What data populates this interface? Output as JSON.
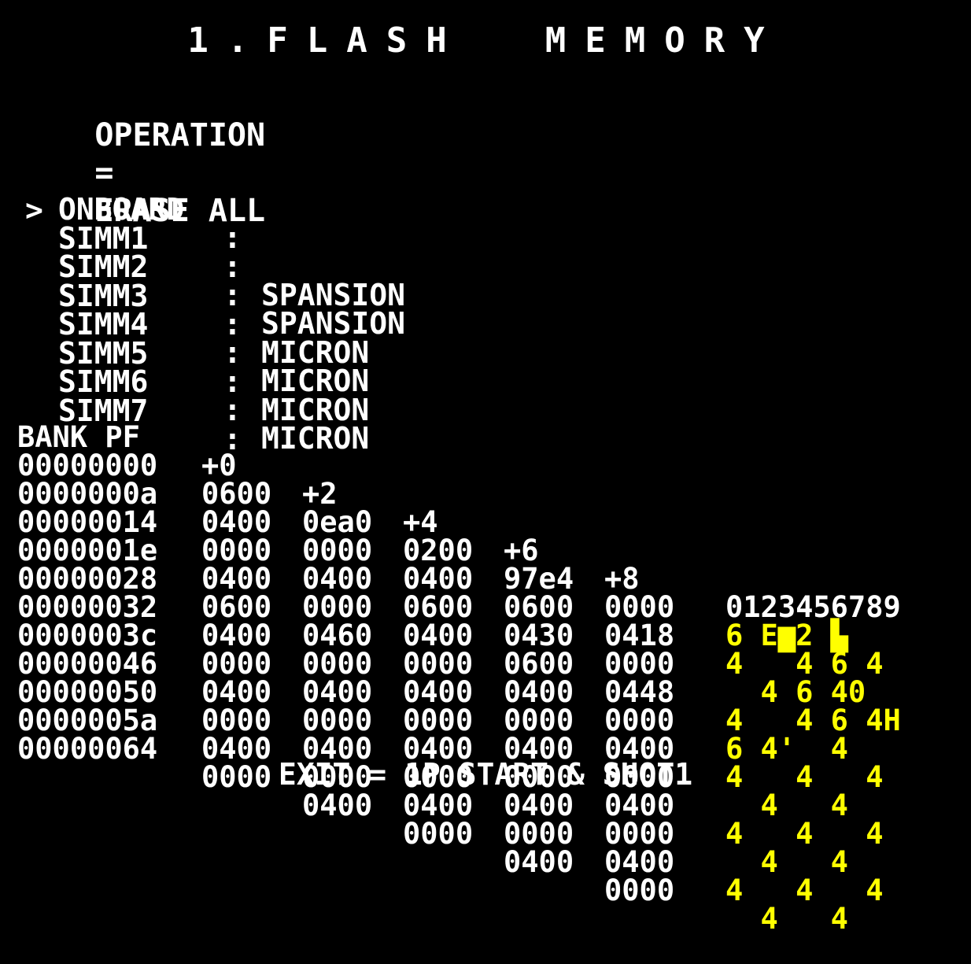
{
  "title": "1.FLASH  MEMORY",
  "operation": {
    "label": "OPERATION",
    "separator": "=",
    "value": "ERASE ALL"
  },
  "devices": [
    {
      "cursor": "",
      "name": "ONBOARD",
      "colon": ":",
      "maker": ""
    },
    {
      "cursor": ">",
      "name": "SIMM1",
      "colon": ":",
      "maker": "SPANSION"
    },
    {
      "cursor": "",
      "name": "SIMM2",
      "colon": ":",
      "maker": "SPANSION"
    },
    {
      "cursor": "",
      "name": "SIMM3",
      "colon": ":",
      "maker": "MICRON"
    },
    {
      "cursor": "",
      "name": "SIMM4",
      "colon": ":",
      "maker": "MICRON"
    },
    {
      "cursor": "",
      "name": "SIMM5",
      "colon": ":",
      "maker": "MICRON"
    },
    {
      "cursor": "",
      "name": "SIMM6",
      "colon": ":",
      "maker": "MICRON"
    },
    {
      "cursor": "",
      "name": "SIMM7",
      "colon": ":",
      "maker": ""
    }
  ],
  "dump": {
    "header": {
      "addr": "BANK PF",
      "w0": "+0",
      "w1": "+2",
      "w2": "+4",
      "w3": "+6",
      "w4": "+8",
      "ascii": "0123456789"
    },
    "rows": [
      {
        "addr": "00000000",
        "w": [
          "0600",
          "0ea0",
          "0200",
          "97e4",
          "0000"
        ],
        "ascii": "6 E▆2 ▙ "
      },
      {
        "addr": "0000000a",
        "w": [
          "0400",
          "0000",
          "0400",
          "0600",
          "0418"
        ],
        "ascii": "4   4 6 4 "
      },
      {
        "addr": "00000014",
        "w": [
          "0000",
          "0400",
          "0600",
          "0430",
          "0000"
        ],
        "ascii": "  4 6 40  "
      },
      {
        "addr": "0000001e",
        "w": [
          "0400",
          "0000",
          "0400",
          "0600",
          "0448"
        ],
        "ascii": "4   4 6 4H"
      },
      {
        "addr": "00000028",
        "w": [
          "0600",
          "0460",
          "0000",
          "0400",
          "0000"
        ],
        "ascii": "6 4'  4   "
      },
      {
        "addr": "00000032",
        "w": [
          "0400",
          "0000",
          "0400",
          "0000",
          "0400"
        ],
        "ascii": "4   4   4 "
      },
      {
        "addr": "0000003c",
        "w": [
          "0000",
          "0400",
          "0000",
          "0400",
          "0000"
        ],
        "ascii": "  4   4   "
      },
      {
        "addr": "00000046",
        "w": [
          "0400",
          "0000",
          "0400",
          "0000",
          "0400"
        ],
        "ascii": "4   4   4 "
      },
      {
        "addr": "00000050",
        "w": [
          "0000",
          "0400",
          "0000",
          "0400",
          "0000"
        ],
        "ascii": "  4   4   "
      },
      {
        "addr": "0000005a",
        "w": [
          "0400",
          "0000",
          "0400",
          "0000",
          "0400"
        ],
        "ascii": "4   4   4 "
      },
      {
        "addr": "00000064",
        "w": [
          "0000",
          "0400",
          "0000",
          "0400",
          "0000"
        ],
        "ascii": "  4   4   "
      }
    ]
  },
  "exit_hint": "EXIT = 1P START & SHOT1",
  "colors": {
    "background": "#000000",
    "text": "#ffffff",
    "ascii": "#ffff00"
  }
}
